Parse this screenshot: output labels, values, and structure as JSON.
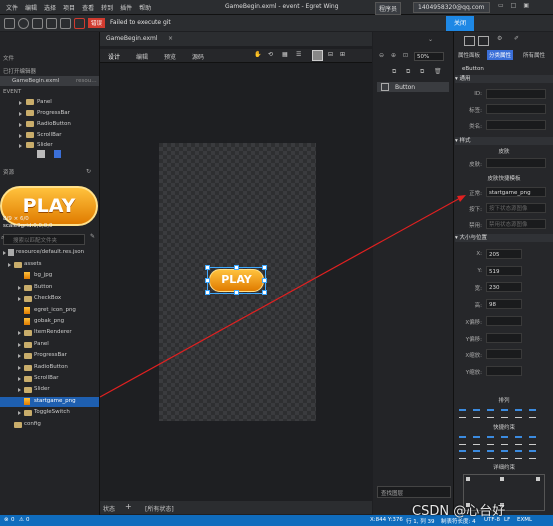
{
  "titlebar": {
    "menu": [
      "文件",
      "编辑",
      "选择",
      "项目",
      "查看",
      "转到",
      "插件",
      "帮助"
    ],
    "window_title": "GameBegin.exml - event - Egret Wing",
    "role_select": "程序员",
    "account": "1404958320@qq.com"
  },
  "notification": {
    "badge": "错误",
    "message": "Failed to execute git",
    "close_label": "关闭"
  },
  "left_panel": {
    "files_header": "文件",
    "open_editors_header": "已打开编辑器",
    "open_file": "GameBegin.exml",
    "open_file_hint": "resou…",
    "event_header": "EVENT",
    "components": [
      "Panel",
      "ProgressBar",
      "RadioButton",
      "ScrollBar",
      "Slider"
    ],
    "resources_header": "资源",
    "preview_info_1": "8/9 × 6/0",
    "preview_info_2": "scale9grid:0,0,0,0",
    "search_placeholder": "搜索以匹配文件夹",
    "resource_file": "resource/default.res.json",
    "tree": [
      {
        "label": "assets",
        "type": "folder-open"
      },
      {
        "label": "bg_jpg",
        "type": "image"
      },
      {
        "label": "Button",
        "type": "folder"
      },
      {
        "label": "CheckBox",
        "type": "folder"
      },
      {
        "label": "egret_icon_png",
        "type": "image"
      },
      {
        "label": "gobak_png",
        "type": "image"
      },
      {
        "label": "ItemRenderer",
        "type": "folder"
      },
      {
        "label": "Panel",
        "type": "folder"
      },
      {
        "label": "ProgressBar",
        "type": "folder"
      },
      {
        "label": "RadioButton",
        "type": "folder"
      },
      {
        "label": "ScrollBar",
        "type": "folder"
      },
      {
        "label": "Slider",
        "type": "folder"
      },
      {
        "label": "startgame_png",
        "type": "image",
        "selected": true
      },
      {
        "label": "ToggleSwitch",
        "type": "folder"
      },
      {
        "label": "config",
        "type": "folder"
      }
    ],
    "preview_text": "PLAY"
  },
  "editor": {
    "tab": "GameBegin.exml",
    "modes": [
      "设计",
      "编辑",
      "预览",
      "源码"
    ],
    "button_text": "PLAY",
    "zoom": "50%",
    "bottom_tabs": [
      "状态",
      "+",
      "[所有状态]"
    ]
  },
  "layers": {
    "item": "Button",
    "search_placeholder": "查找图层"
  },
  "properties": {
    "tabs": [
      "属性面板",
      "分类属性",
      "所有属性"
    ],
    "component": "eButton",
    "sections": {
      "common": "通用",
      "style": "样式",
      "skin": "皮肤",
      "skin_shortcut": "皮肤快捷模板",
      "size_pos": "大小与位置",
      "arrange": "排列",
      "quick_layout": "快捷约束",
      "details": "详细约束"
    },
    "common_labels": [
      "ID:",
      "标签:",
      "类名:"
    ],
    "skin_label": "皮肤:",
    "state_labels": [
      "正常:",
      "按下:",
      "禁用:"
    ],
    "state_values": [
      "startgame_png",
      "按下状态源图像",
      "禁用状态源图像"
    ],
    "size_labels": [
      "X:",
      "Y:",
      "宽:",
      "高:",
      "X偏移:",
      "Y偏移:",
      "X缩放:",
      "Y缩放:"
    ],
    "size_values": [
      "205",
      "519",
      "230",
      "98",
      "",
      "",
      "",
      ""
    ]
  },
  "status_bar": {
    "errors": "0",
    "warnings": "0",
    "coords": "X:844 Y:376",
    "cursor": "行 1, 列 39",
    "tab_size": "制表符长度: 4",
    "encoding": "UTF-8",
    "eol": "LF",
    "lang": "EXML"
  },
  "watermark": "CSDN @心台好"
}
